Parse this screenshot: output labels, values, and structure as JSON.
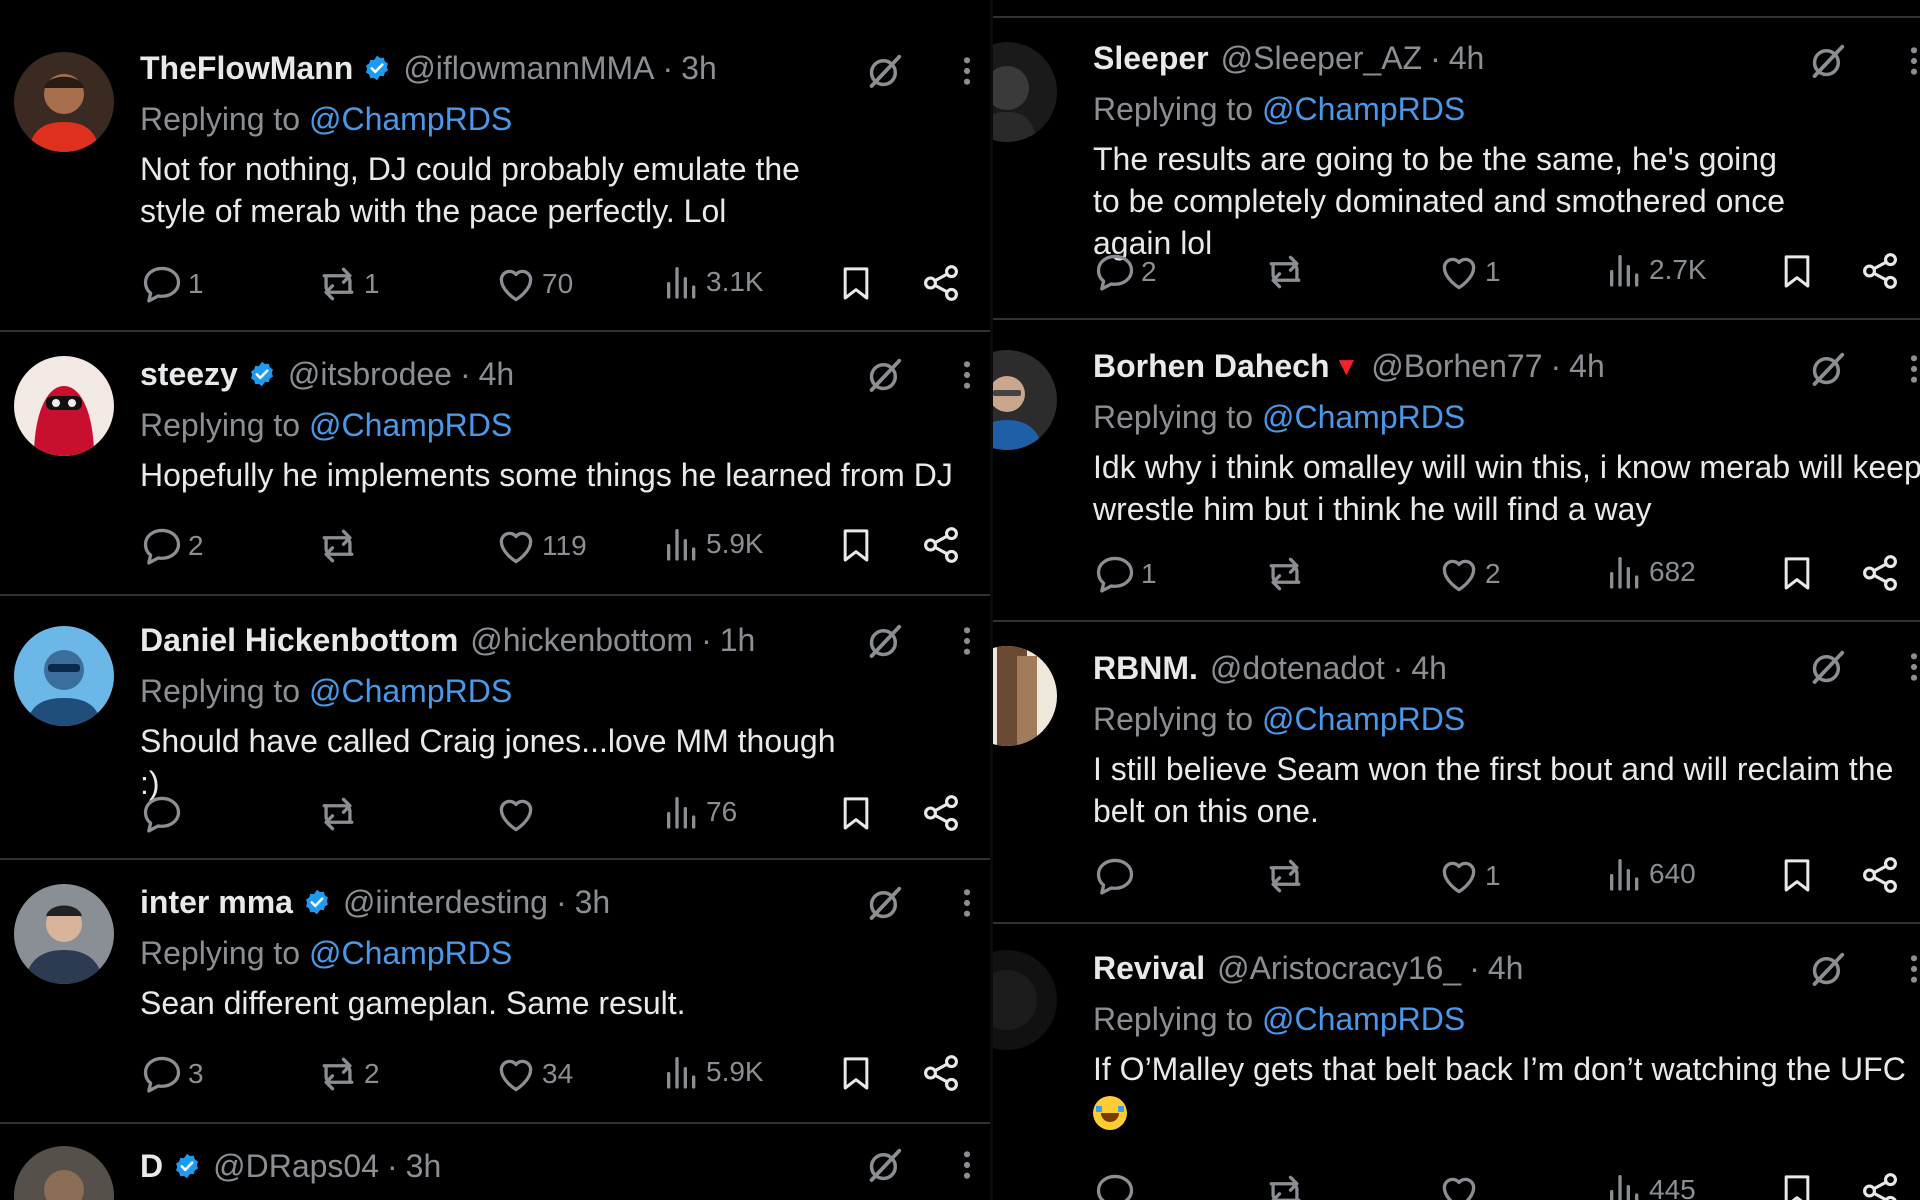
{
  "left": {
    "posts": [
      {
        "name": "TheFlowMann",
        "verified": true,
        "handle": "@iflowmannMMA",
        "time": "3h",
        "reply_prefix": "Replying to",
        "reply_to": "@ChampRDS",
        "text": "Not for nothing, DJ could probably emulate the style of merab with the pace perfectly. Lol",
        "replies": "1",
        "reposts": "1",
        "likes": "70",
        "views": "3.1K"
      },
      {
        "name": "steezy",
        "verified": true,
        "handle": "@itsbrodee",
        "time": "4h",
        "reply_prefix": "Replying to",
        "reply_to": "@ChampRDS",
        "text": "Hopefully he implements some things he learned from DJ",
        "replies": "2",
        "reposts": "",
        "likes": "119",
        "views": "5.9K"
      },
      {
        "name": "Daniel Hickenbottom",
        "verified": false,
        "handle": "@hickenbottom",
        "time": "1h",
        "reply_prefix": "Replying to",
        "reply_to": "@ChampRDS",
        "text": "Should have called Craig jones...love MM though :)",
        "replies": "",
        "reposts": "",
        "likes": "",
        "views": "76"
      },
      {
        "name": "inter mma",
        "verified": true,
        "handle": "@iinterdesting",
        "time": "3h",
        "reply_prefix": "Replying to",
        "reply_to": "@ChampRDS",
        "text": "Sean different gameplan. Same result.",
        "replies": "3",
        "reposts": "2",
        "likes": "34",
        "views": "5.9K"
      },
      {
        "name": "D",
        "verified": true,
        "handle": "@DRaps04",
        "time": "3h"
      }
    ]
  },
  "right": {
    "posts": [
      {
        "name": "Sleeper",
        "handle": "@Sleeper_AZ",
        "time": "4h",
        "reply_prefix": "Replying to",
        "reply_to": "@ChampRDS",
        "text": "The results are going to be the same, he's going to be completely dominated and smothered once again lol",
        "replies": "2",
        "reposts": "",
        "likes": "1",
        "views": "2.7K"
      },
      {
        "name": "Borhen Dahech",
        "flag": "▼",
        "handle": "@Borhen77",
        "time": "4h",
        "reply_prefix": "Replying to",
        "reply_to": "@ChampRDS",
        "text": "Idk why i think omalley will win this, i know merab will keep wrestle him but i think he will find a way",
        "replies": "1",
        "reposts": "",
        "likes": "2",
        "views": "682"
      },
      {
        "name": "RBNM.",
        "handle": "@dotenadot",
        "time": "4h",
        "reply_prefix": "Replying to",
        "reply_to": "@ChampRDS",
        "text": "I still believe Seam won the first bout and will reclaim the belt on this one.",
        "replies": "",
        "reposts": "",
        "likes": "1",
        "views": "640"
      },
      {
        "name": "Revival",
        "handle": "@Aristocracy16_",
        "time": "4h",
        "reply_prefix": "Replying to",
        "reply_to": "@ChampRDS",
        "text": "If O’Malley gets that belt back I’m don’t watching the UFC",
        "emoji": "tears-of-joy-emoji",
        "replies": "",
        "reposts": "",
        "likes": "",
        "views": "445"
      }
    ]
  },
  "colors": {
    "background": "#000000",
    "text": "#e7e9ea",
    "muted": "#8b8f94",
    "link": "#4a99e9",
    "verified": "#1d9bf0",
    "divider": "#2f3336"
  },
  "icons": [
    "grok-icon",
    "more-icon",
    "reply-icon",
    "repost-icon",
    "like-icon",
    "views-icon",
    "bookmark-icon",
    "share-icon",
    "verified-badge-icon"
  ]
}
